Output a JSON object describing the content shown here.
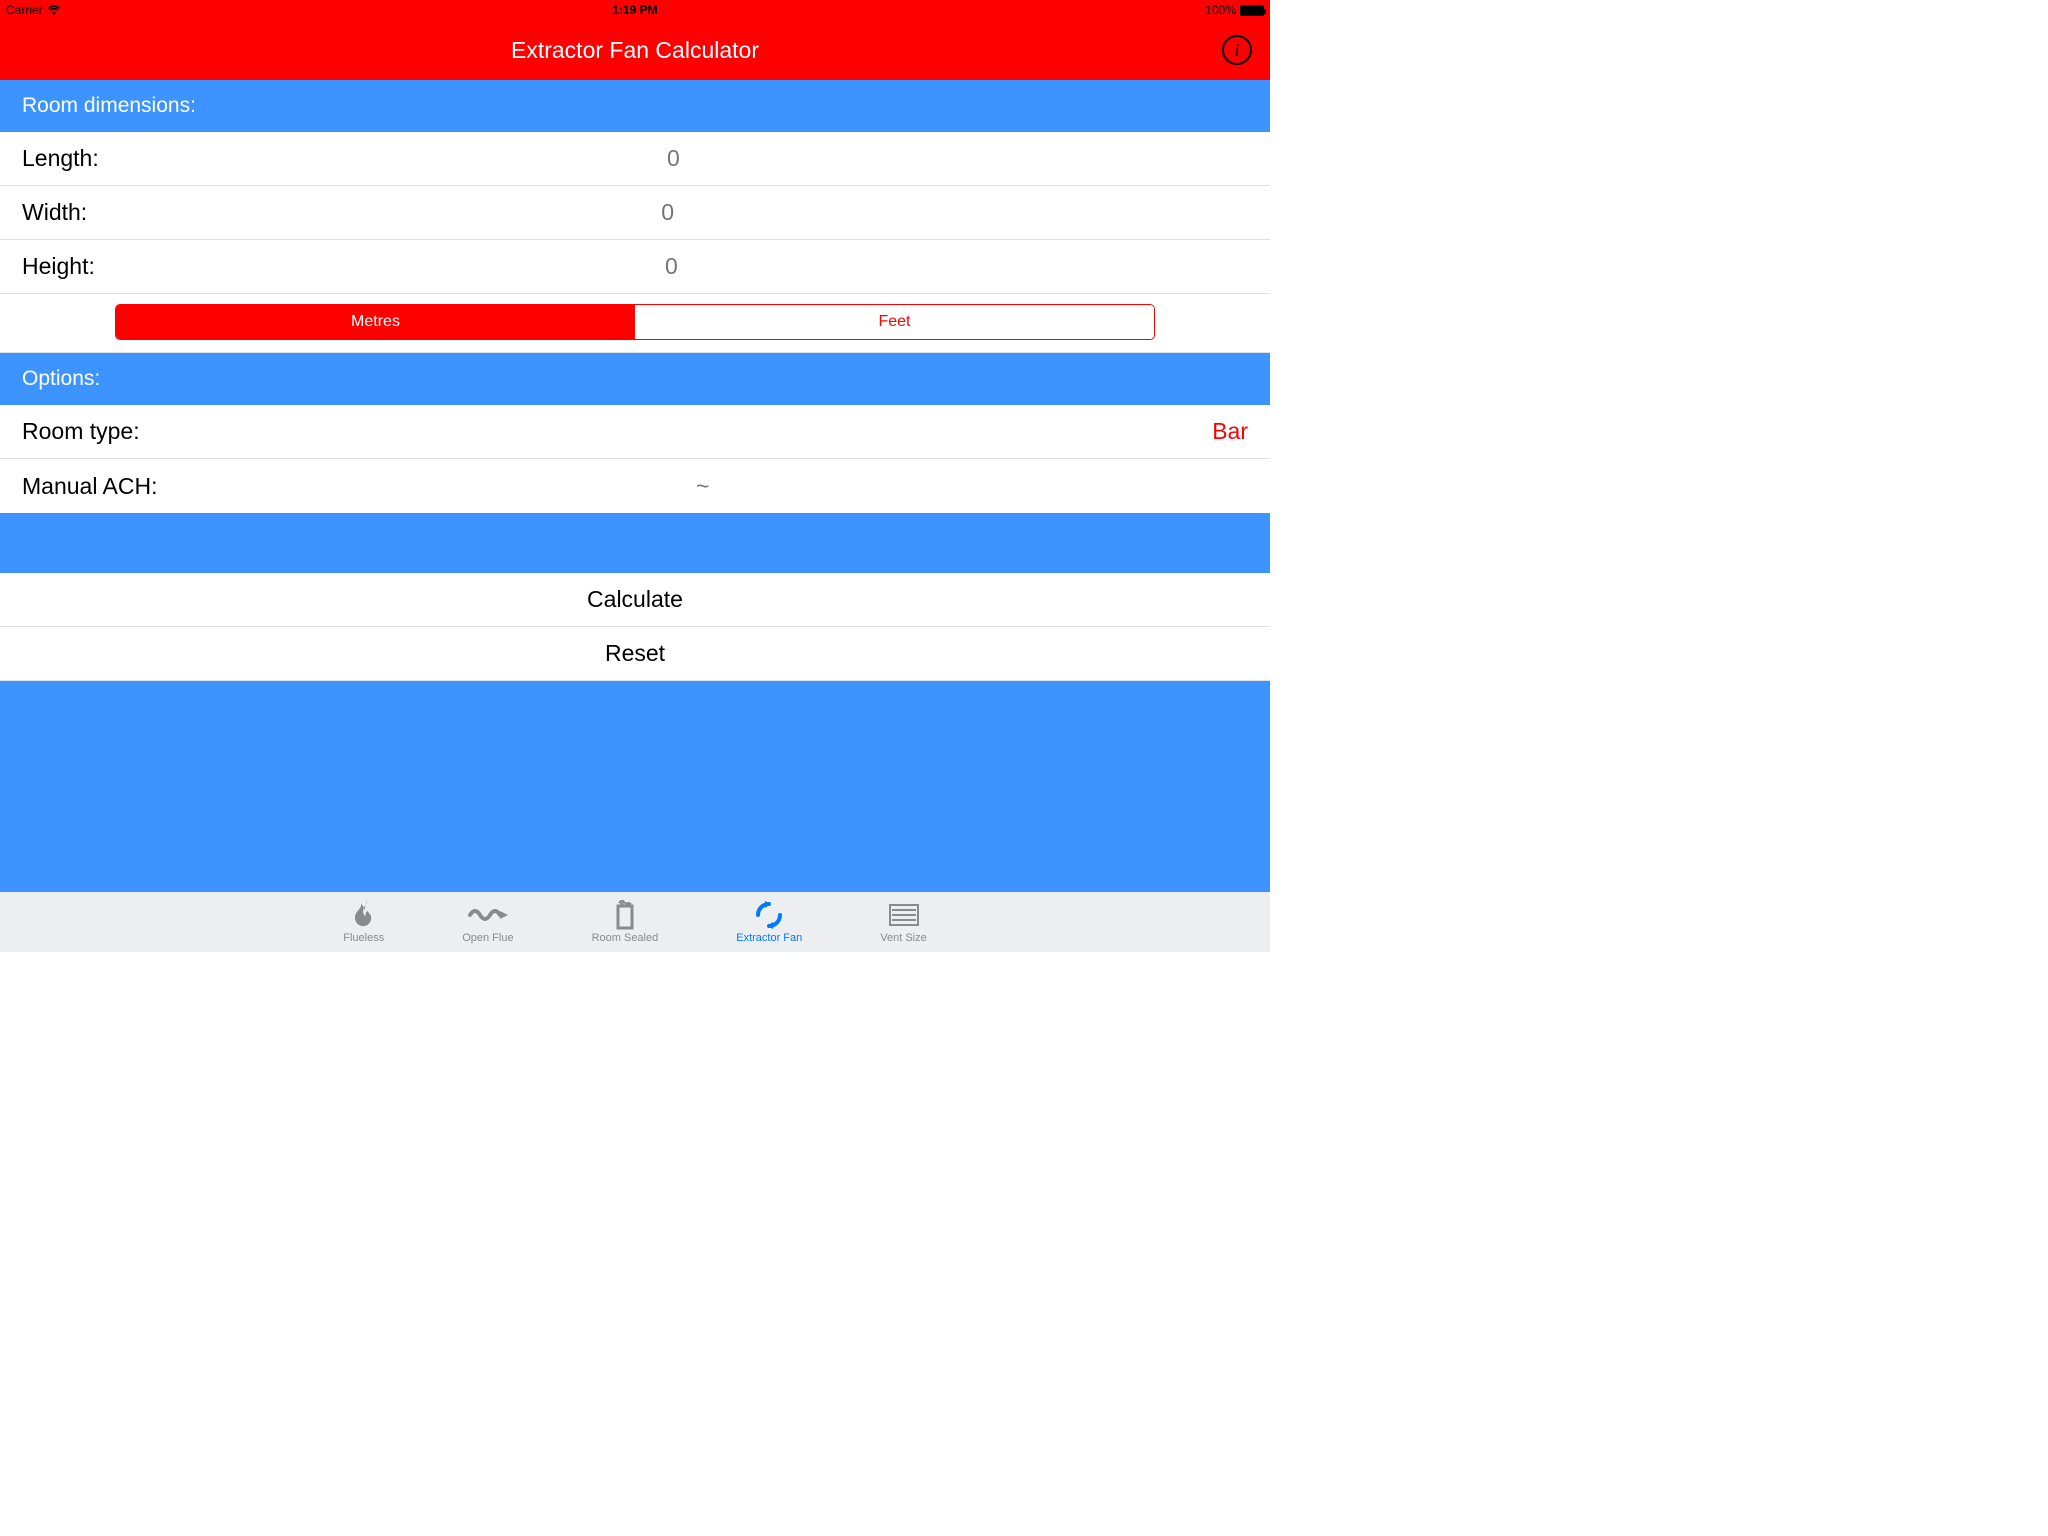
{
  "status": {
    "carrier": "Carrier",
    "time": "1:19 PM",
    "battery": "100%"
  },
  "nav": {
    "title": "Extractor Fan Calculator"
  },
  "sections": {
    "room_dim_header": "Room dimensions:",
    "options_header": "Options:"
  },
  "fields": {
    "length_label": "Length:",
    "length_placeholder": "0",
    "width_label": "Width:",
    "width_placeholder": "0",
    "height_label": "Height:",
    "height_placeholder": "0",
    "units": {
      "metres": "Metres",
      "feet": "Feet"
    },
    "room_type_label": "Room type:",
    "room_type_value": "Bar",
    "manual_ach_label": "Manual ACH:",
    "manual_ach_placeholder": "~"
  },
  "actions": {
    "calculate": "Calculate",
    "reset": "Reset"
  },
  "tabs": {
    "flueless": "Flueless",
    "open_flue": "Open Flue",
    "room_sealed": "Room Sealed",
    "extractor_fan": "Extractor Fan",
    "vent_size": "Vent Size"
  }
}
